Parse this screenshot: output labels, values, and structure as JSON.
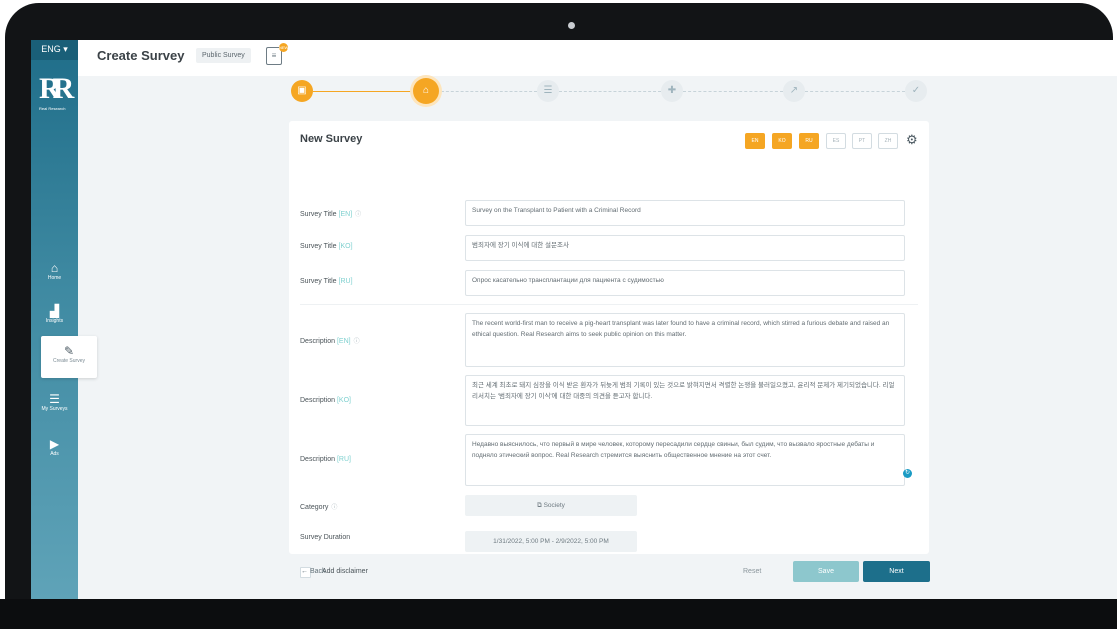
{
  "sidebar": {
    "language": "ENG ▾",
    "logo_letters": "R",
    "logo_subtitle": "Real Research",
    "items": [
      {
        "label": "Home",
        "icon": "home-icon",
        "glyph": "⌂"
      },
      {
        "label": "Insights",
        "icon": "chart-icon",
        "glyph": "▟"
      },
      {
        "label": "Create Survey",
        "icon": "pencil-icon",
        "glyph": "✎"
      },
      {
        "label": "My Surveys",
        "icon": "list-icon",
        "glyph": "☰"
      },
      {
        "label": "Ads",
        "icon": "play-icon",
        "glyph": "▶"
      }
    ]
  },
  "header": {
    "title": "Create Survey",
    "chip": "Public Survey",
    "badge": "NEW",
    "avatar": "SP"
  },
  "stepper": {
    "steps": [
      {
        "icon": "briefcase-icon",
        "glyph": "▣",
        "state": "done"
      },
      {
        "icon": "bank-icon",
        "glyph": "⌂",
        "state": "current"
      },
      {
        "icon": "list-icon",
        "glyph": "☰",
        "state": "todo"
      },
      {
        "icon": "puzzle-icon",
        "glyph": "✚",
        "state": "todo"
      },
      {
        "icon": "trend-icon",
        "glyph": "↗",
        "state": "todo"
      },
      {
        "icon": "check-icon",
        "glyph": "✓",
        "state": "todo"
      }
    ]
  },
  "card": {
    "title": "New Survey",
    "lang_tabs": [
      {
        "code": "EN",
        "active": true
      },
      {
        "code": "KO",
        "active": true
      },
      {
        "code": "RU",
        "active": true
      },
      {
        "code": "ES",
        "active": false
      },
      {
        "code": "PT",
        "active": false
      },
      {
        "code": "ZH",
        "active": false
      }
    ],
    "survey_title": {
      "label": "Survey Title",
      "en": "Survey on the Transplant to Patient with a Criminal Record",
      "ko": "범죄자에 장기 이식에 대한 설문조사",
      "ru": "Опрос касательно трансплантации для пациента с судимостью"
    },
    "description": {
      "label": "Description",
      "en": "The recent world-first man to receive a pig-heart transplant was later found to have a criminal record, which stirred a furious debate and raised an ethical question. Real Research aims to seek public opinion on this matter.",
      "ko": "최근 세계 최초로 돼지 심장을 이식 받은 환자가 뒤늦게 범죄 기록이 있는 것으로 밝혀지면서 격렬한 논쟁을 불러일으켰고, 윤리적 문제가 제기되었습니다. 리얼 리서치는 '범죄자에 장기 이식'에 대한 대중의 의견을 듣고자 합니다.",
      "ru": "Недавно выяснилось, что первый в мире человек, которому пересадили сердце свиньи, был судим, что вызвало яростные дебаты и подняло этический вопрос. Real Research стремится выяснить общественное мнение на этот счет."
    },
    "tags": {
      "en": "[EN]",
      "ko": "[KO]",
      "ru": "[RU]"
    },
    "category": {
      "label": "Category",
      "value": "Society"
    },
    "duration": {
      "label": "Survey Duration",
      "value": "1/31/2022, 5:00 PM - 2/9/2022, 5:00 PM"
    },
    "disclaimer": {
      "label": "Add disclaimer"
    }
  },
  "footer": {
    "back": "Back",
    "reset": "Reset",
    "save": "Save",
    "next": "Next"
  },
  "colors": {
    "accent": "#f5a623",
    "primary": "#1d6f8b",
    "save_disabled": "#8dc7cd",
    "lang_tag": "#7ed0cf"
  }
}
